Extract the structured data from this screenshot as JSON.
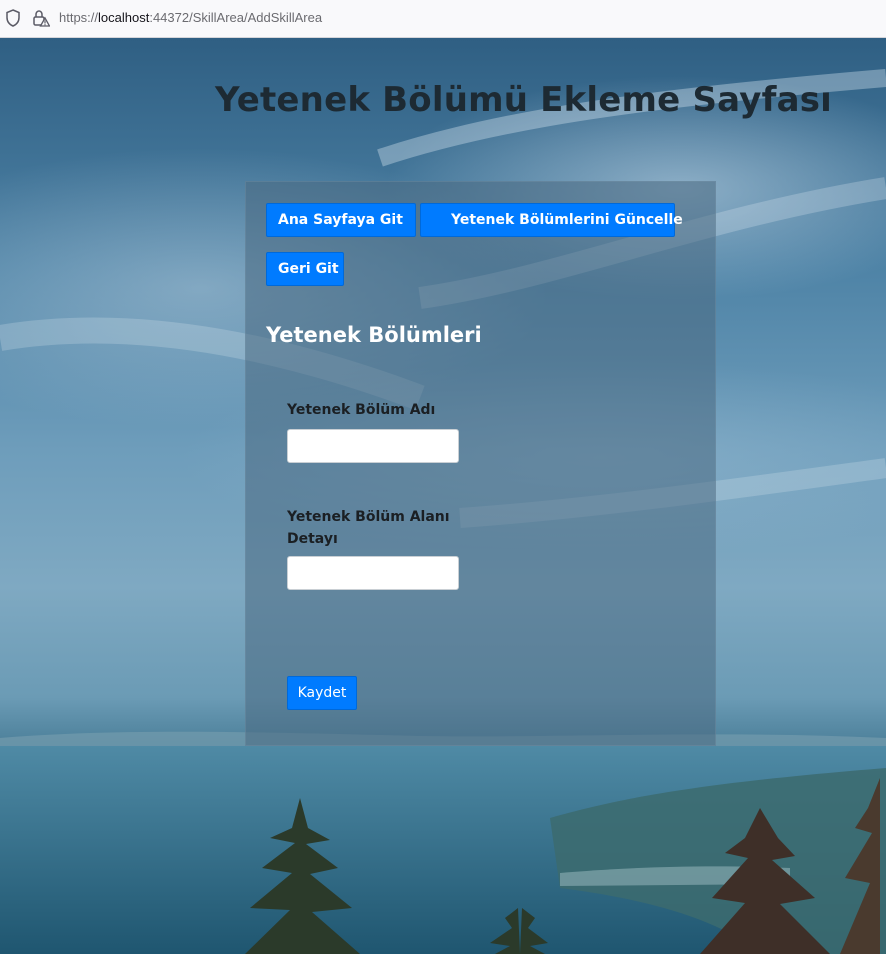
{
  "browser": {
    "url_scheme": "https://",
    "url_host": "localhost",
    "url_rest": ":44372/SkillArea/AddSkillArea"
  },
  "page": {
    "title": "Yetenek Bölümü Ekleme Sayfası"
  },
  "nav": {
    "home_label": "Ana Sayfaya Git",
    "update_label": "Yetenek Bölümlerini Güncelle",
    "back_label": "Geri Git"
  },
  "form": {
    "section_title": "Yetenek Bölümleri",
    "name_label": "Yetenek Bölüm Adı",
    "name_value": "",
    "detail_label": "Yetenek Bölüm Alanı Detayı",
    "detail_value": "",
    "save_label": "Kaydet"
  },
  "colors": {
    "primary": "#007bff",
    "panel": "rgba(75,105,130,0.55)"
  }
}
